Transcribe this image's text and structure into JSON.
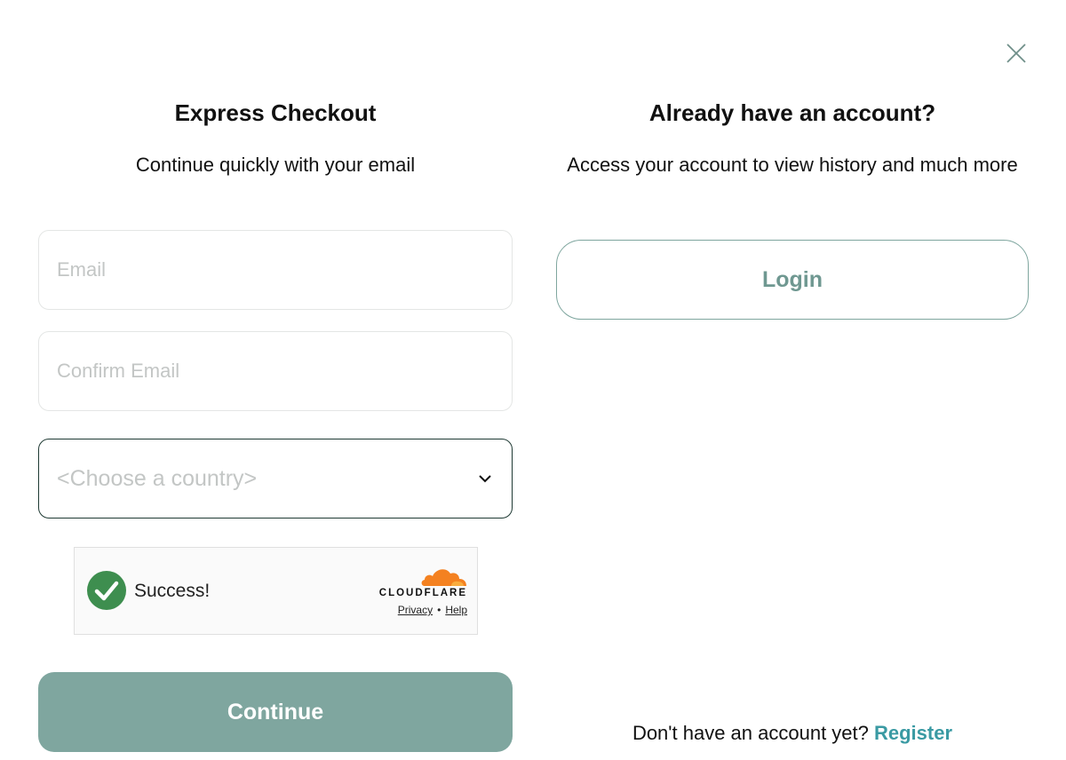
{
  "icons": {
    "close": "close-icon",
    "chevron": "chevron-down-icon",
    "success": "check-circle-icon",
    "cloudflare": "cloudflare-cloud-icon"
  },
  "colors": {
    "accent": "#7fa69f",
    "accent_text": "#6f9891",
    "link": "#3a9aa3",
    "success_green": "#3e8e4f",
    "cloudflare_orange": "#f48120"
  },
  "express": {
    "title": "Express Checkout",
    "subtitle": "Continue quickly with your email",
    "email_placeholder": "Email",
    "confirm_email_placeholder": "Confirm Email",
    "country_placeholder": "<Choose a country>",
    "continue_label": "Continue"
  },
  "turnstile": {
    "status": "Success!",
    "brand": "CLOUDFLARE",
    "privacy_label": "Privacy",
    "separator": "•",
    "help_label": "Help"
  },
  "account": {
    "title": "Already have an account?",
    "subtitle": "Access your account to view history and much more",
    "login_label": "Login",
    "register_prompt": "Don't have an account yet?",
    "register_label": "Register"
  }
}
